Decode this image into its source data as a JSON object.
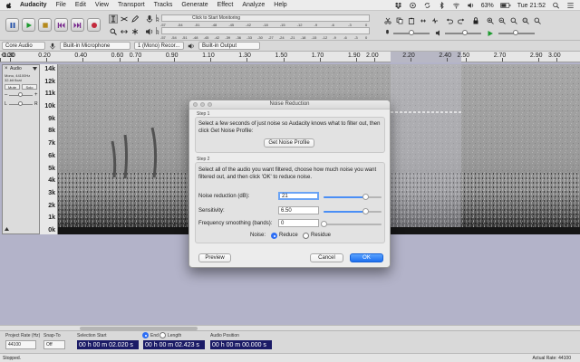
{
  "menubar": {
    "app": "Audacity",
    "items": [
      "File",
      "Edit",
      "View",
      "Transport",
      "Tracks",
      "Generate",
      "Effect",
      "Analyze",
      "Help"
    ],
    "battery": "63%",
    "clock": "Tue 21:52"
  },
  "meter": {
    "record_label": "Click to Start Monitoring",
    "record_ticks": [
      "-57",
      "-54",
      "-51",
      "-48",
      "-45",
      "-42",
      "-18",
      "-15",
      "-12",
      "-9",
      "-6",
      "-3",
      "0"
    ],
    "play_ticks": [
      "-57",
      "-54",
      "-51",
      "-48",
      "-45",
      "-42",
      "-39",
      "-36",
      "-33",
      "-30",
      "-27",
      "-24",
      "-21",
      "-18",
      "-15",
      "-12",
      "-9",
      "-6",
      "-3",
      "0"
    ]
  },
  "devices": {
    "host": "Core Audio",
    "input": "Built-in Microphone",
    "channels": "1 (Mono) Recor...",
    "output": "Built-in Output"
  },
  "ruler": {
    "ticks": [
      {
        "label": "-0.30",
        "v": -0.3
      },
      {
        "label": "0.00",
        "v": 0.0
      },
      {
        "label": "0.20",
        "v": 0.2
      },
      {
        "label": "0.40",
        "v": 0.4
      },
      {
        "label": "0.60",
        "v": 0.6
      },
      {
        "label": "0.70",
        "v": 0.7
      },
      {
        "label": "0.90",
        "v": 0.9
      },
      {
        "label": "1.10",
        "v": 1.1
      },
      {
        "label": "1.30",
        "v": 1.3
      },
      {
        "label": "1.50",
        "v": 1.5
      },
      {
        "label": "1.70",
        "v": 1.7
      },
      {
        "label": "1.90",
        "v": 1.9
      },
      {
        "label": "2.00",
        "v": 2.0
      },
      {
        "label": "2.20",
        "v": 2.2
      },
      {
        "label": "2.40",
        "v": 2.4
      },
      {
        "label": "2.50",
        "v": 2.5
      },
      {
        "label": "2.70",
        "v": 2.7
      },
      {
        "label": "2.90",
        "v": 2.9
      },
      {
        "label": "3.00",
        "v": 3.0
      }
    ]
  },
  "track": {
    "name": "Audio",
    "info_line1": "Mono, 44100Hz",
    "info_line2": "32-bit float",
    "mute": "Mute",
    "solo": "Solo",
    "scale_labels": [
      "14k",
      "12k",
      "11k",
      "10k",
      "9k",
      "8k",
      "7k",
      "6k",
      "5k",
      "4k",
      "3k",
      "2k",
      "1k",
      "0k"
    ]
  },
  "dialog": {
    "title": "Noise Reduction",
    "step1_label": "Step 1",
    "step1_text": "Select a few seconds of just noise so Audacity knows what to filter out, then click Get Noise Profile:",
    "get_profile_btn": "Get Noise Profile",
    "step2_label": "Step 2",
    "step2_text": "Select all of the audio you want filtered, choose how much noise you want filtered out, and then click 'OK' to reduce noise.",
    "nr_label": "Noise reduction (dB):",
    "nr_value": "21",
    "nr_fraction": 0.72,
    "sens_label": "Sensitivity:",
    "sens_value": "6.50",
    "sens_fraction": 0.72,
    "freq_label": "Frequency smoothing (bands):",
    "freq_value": "0",
    "freq_fraction": 0.0,
    "noise_label": "Noise:",
    "reduce_label": "Reduce",
    "residue_label": "Residue",
    "preview_btn": "Preview",
    "cancel_btn": "Cancel",
    "ok_btn": "OK"
  },
  "selection_bar": {
    "rate_label": "Project Rate (Hz)",
    "rate_value": "44100",
    "snap_label": "Snap-To",
    "snap_value": "Off",
    "sel_label": "Selection Start",
    "end_label": "End",
    "length_label": "Length",
    "start_time": "00 h 00 m 02.020 s",
    "end_time": "00 h 00 m 02.423 s",
    "pos_label": "Audio Position",
    "pos_time": "00 h 00 m 00.000 s"
  },
  "status": {
    "left": "Stopped.",
    "right": "Actual Rate: 44100"
  },
  "colors": {
    "accent": "#2d6ef5",
    "track_bg": "#b3b3c9",
    "time_bg": "#1b1b66"
  }
}
